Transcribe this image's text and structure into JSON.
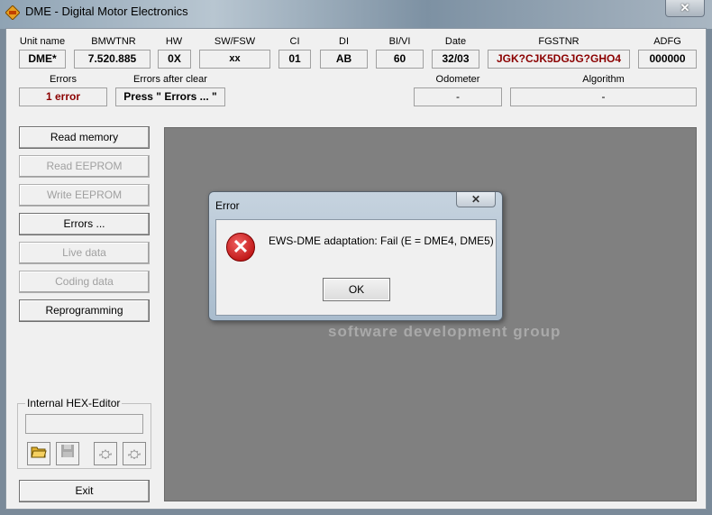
{
  "window": {
    "title": "DME - Digital Motor Electronics",
    "close": "✕"
  },
  "info": {
    "unit_name": {
      "label": "Unit name",
      "value": "DME*"
    },
    "bmwtnr": {
      "label": "BMWTNR",
      "value": "7.520.885"
    },
    "hw": {
      "label": "HW",
      "value": "0X"
    },
    "sw": {
      "label": "SW/FSW",
      "value": "xx"
    },
    "ci": {
      "label": "CI",
      "value": "01"
    },
    "di": {
      "label": "DI",
      "value": "AB"
    },
    "bivi": {
      "label": "BI/VI",
      "value": "60"
    },
    "date": {
      "label": "Date",
      "value": "32/03"
    },
    "fgstnr": {
      "label": "FGSTNR",
      "value": "JGK?CJK5DGJG?GHO4"
    },
    "adfg": {
      "label": "ADFG",
      "value": "000000"
    },
    "errors": {
      "label": "Errors",
      "value": "1 error"
    },
    "errors_after": {
      "label": "Errors after clear",
      "value": "Press \" Errors ... \""
    },
    "odometer": {
      "label": "Odometer",
      "value": "-"
    },
    "algorithm": {
      "label": "Algorithm",
      "value": "-"
    }
  },
  "buttons": [
    {
      "label": "Read memory",
      "enabled": true
    },
    {
      "label": "Read EEPROM",
      "enabled": false
    },
    {
      "label": "Write EEPROM",
      "enabled": false
    },
    {
      "label": "Errors ...",
      "enabled": true
    },
    {
      "label": "Live data",
      "enabled": false
    },
    {
      "label": "Coding data",
      "enabled": false
    },
    {
      "label": "Reprogramming",
      "enabled": true
    }
  ],
  "hex_editor": {
    "label": "Internal HEX-Editor",
    "value": ""
  },
  "exit_label": "Exit",
  "watermark": {
    "tagline": "software development group"
  },
  "dialog": {
    "title": "Error",
    "message": "EWS-DME adaptation: Fail (E = DME4, DME5)",
    "ok": "OK",
    "close": "✕"
  },
  "colors": {
    "error_text": "#8b0000",
    "panel": "#808080"
  }
}
